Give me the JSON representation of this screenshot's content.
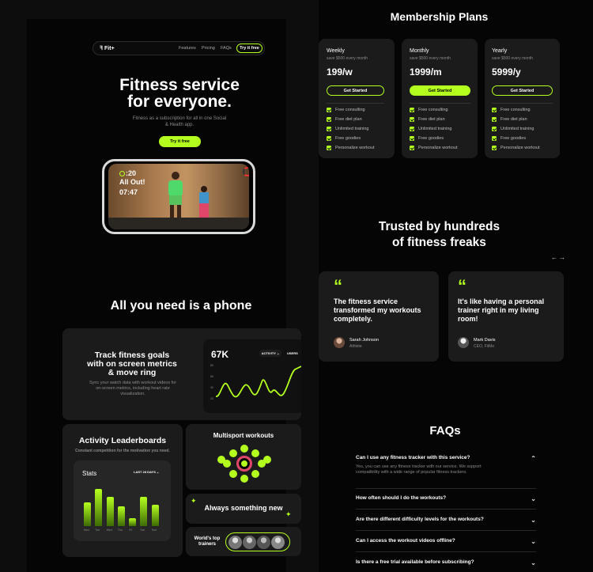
{
  "colors": {
    "accent": "#b5ff1f",
    "bg": "#050505",
    "card": "#1b1b1b"
  },
  "nav": {
    "logo": "Fit+",
    "links": [
      "Features",
      "Pricing",
      "FAQs"
    ],
    "cta": "Try it free"
  },
  "hero": {
    "title_line1": "Fitness service",
    "title_line2": "for everyone.",
    "subtitle_line1": "Fitness as a subscription for all in one Social",
    "subtitle_line2": "& Health app.",
    "cta": "Try it free",
    "overlay_time": ":20",
    "overlay_label": "All Out!",
    "overlay_clock": "07:47"
  },
  "phone_section": {
    "title": "All you need is a phone"
  },
  "track": {
    "title_line1": "Track fitness goals",
    "title_line2": "with on screen metrics",
    "title_line3": "& move ring",
    "desc_line1": "Sync your watch data with workout videos for",
    "desc_line2": "on-screen metrics, including heart rate",
    "desc_line3": "visualization.",
    "metric": "67K",
    "activity_label": "ACTIVITY",
    "users_label": "USERS",
    "y_ticks": [
      "80",
      "60",
      "40",
      "20"
    ]
  },
  "leaderboard": {
    "title": "Activity Leaderboards",
    "subtitle": "Constant competition for the motivation you need.",
    "stats_title": "Stats",
    "range": "LAST 28 DAYS",
    "bar_values": [
      0.6,
      0.95,
      0.75,
      0.5,
      0.2,
      0.75,
      0.55
    ],
    "x_labels": [
      "Mon",
      "Tue",
      "Wed",
      "Thu",
      "Fri",
      "Sat",
      "Sun"
    ]
  },
  "multisport": {
    "title": "Multisport workouts"
  },
  "always_new": {
    "title": "Always something new"
  },
  "trainers": {
    "title_line1": "World's top",
    "title_line2": "trainers"
  },
  "membership": {
    "title": "Membership Plans",
    "plans": [
      {
        "name": "Weekly",
        "note": "save $500 every month",
        "price": "199/w",
        "cta": "Get Started"
      },
      {
        "name": "Monthly",
        "note": "save $500 every month",
        "price": "1999/m",
        "cta": "Get Started"
      },
      {
        "name": "Yearly",
        "note": "save $500 every month",
        "price": "5999/y",
        "cta": "Get Started"
      }
    ],
    "features": [
      "Free consulting",
      "Free diet plan",
      "Unlimited training",
      "Free goodies",
      "Personalize workout"
    ]
  },
  "trusted": {
    "title_line1": "Trusted by hundreds",
    "title_line2": "of fitness freaks",
    "prev": "←",
    "next": "→",
    "testimonials": [
      {
        "quote": "The fitness service transformed my workouts completely.",
        "name": "Sarah Johnson",
        "role": "Athlete"
      },
      {
        "quote": "It's like having a personal trainer right in my living room!",
        "name": "Mark Davis",
        "role": "CEO, FitMe"
      }
    ]
  },
  "faqs": {
    "title": "FAQs",
    "items": [
      {
        "q": "Can I use any fitness tracker with this service?",
        "a": "Yes, you can use any fitness tracker with our service. We support compatibility with a wide range of popular fitness trackers."
      },
      {
        "q": "How often should I do the workouts?"
      },
      {
        "q": "Are there different difficulty levels for the workouts?"
      },
      {
        "q": "Can I access the workout videos offline?"
      },
      {
        "q": "Is there a free trial available before subscribing?"
      }
    ]
  }
}
